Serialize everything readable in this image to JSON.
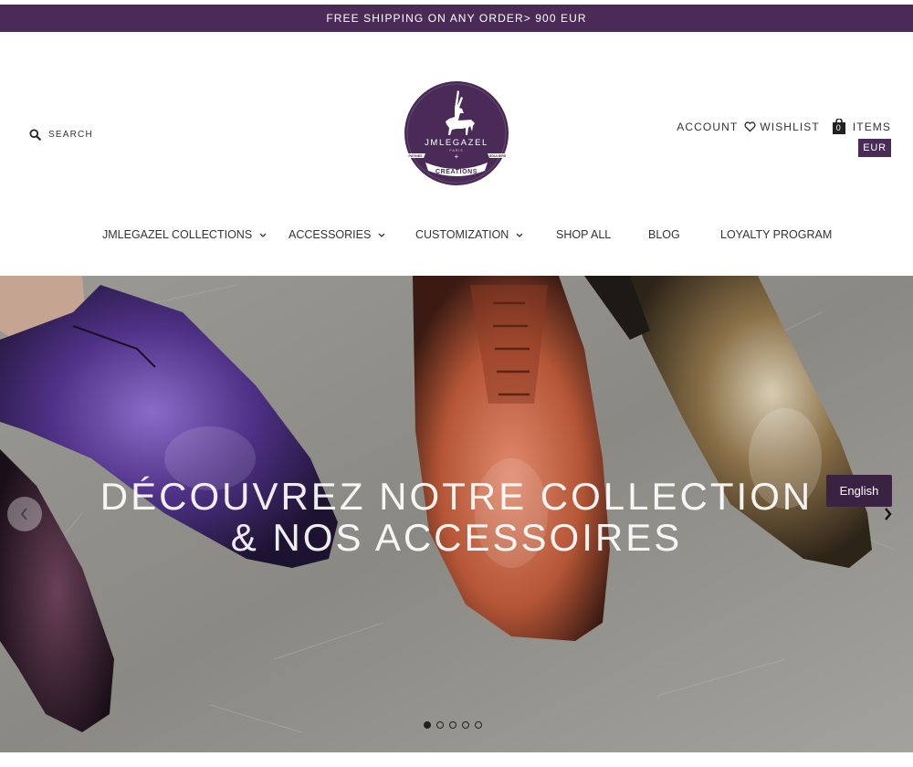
{
  "promo": {
    "text": "FREE SHIPPING ON ANY ORDER> 900 EUR"
  },
  "header": {
    "search_label": "SEARCH",
    "logo": {
      "brand": "JMLEGAZEL",
      "city": "PARIS",
      "left_ribbon": "PATINES",
      "right_ribbon": "SOULIERS",
      "bottom_ribbon": "CREATIONS",
      "color": "#4a2b57"
    },
    "account_label": "ACCOUNT",
    "wishlist_label": "WISHLIST",
    "cart_count": "0",
    "items_label": "ITEMS",
    "currency": "EUR"
  },
  "nav": {
    "items": [
      {
        "label": "JMLEGAZEL COLLECTIONS",
        "dropdown": true
      },
      {
        "label": "ACCESSORIES",
        "dropdown": true
      },
      {
        "label": "CUSTOMIZATION",
        "dropdown": true
      },
      {
        "label": "SHOP ALL",
        "dropdown": false
      },
      {
        "label": "BLOG",
        "dropdown": false
      },
      {
        "label": "LOYALTY PROGRAM",
        "dropdown": false
      }
    ]
  },
  "hero": {
    "headline_line1": "DÉCOUVREZ NOTRE COLLECTION",
    "headline_line2": "& NOS ACCESSOIRES",
    "language_button": "English",
    "slides_total": 5,
    "active_slide": 1,
    "icons": {
      "prev": "chevron-left-icon",
      "next": "chevron-right-icon"
    }
  },
  "colors": {
    "brand": "#4a2b57",
    "dark": "#222222",
    "white": "#ffffff"
  }
}
